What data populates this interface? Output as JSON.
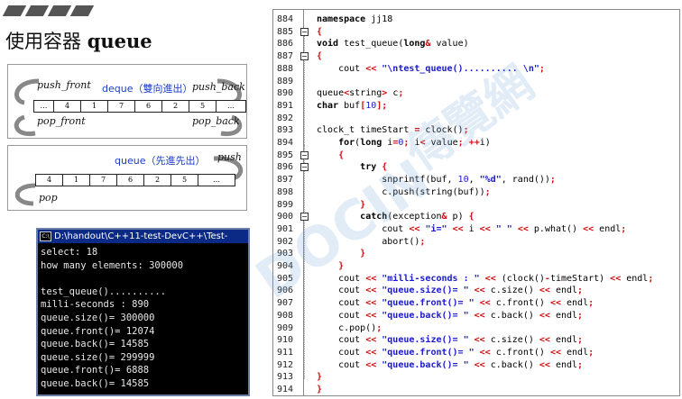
{
  "heading": {
    "title_prefix": "使用容器",
    "title_word": "queue"
  },
  "deque_diagram": {
    "title": "deque（雙向進出）",
    "push_front": "push_front",
    "push_back": "push_back",
    "pop_front": "pop_front",
    "pop_back": "pop_back",
    "cells": [
      "…",
      "4",
      "1",
      "7",
      "6",
      "2",
      "5",
      "…"
    ]
  },
  "queue_diagram": {
    "title": "queue（先進先出）",
    "push": "push",
    "pop": "pop",
    "cells": [
      "4",
      "1",
      "7",
      "6",
      "2",
      "5",
      "…"
    ]
  },
  "console": {
    "title": "D:\\handout\\C++11-test-DevC++\\Test-",
    "icon": "C:\\",
    "lines": [
      "select: 18",
      "how many elements: 300000",
      "",
      "test_queue()..........",
      "milli-seconds : 890",
      "queue.size()= 300000",
      "queue.front()= 12074",
      "queue.back()= 14585",
      "queue.size()= 299999",
      "queue.front()= 6888",
      "queue.back()= 14585"
    ]
  },
  "code": {
    "lines": [
      {
        "n": "884",
        "html": "<span class=\"kw\">namespace</span> jj18"
      },
      {
        "n": "885",
        "html": "<span class=\"op\">{</span>"
      },
      {
        "n": "886",
        "html": "<span class=\"kw\">void</span> test_queue(<span class=\"kw\">long</span><span class=\"op\">&amp;</span> value)"
      },
      {
        "n": "887",
        "html": "<span class=\"op\">{</span>"
      },
      {
        "n": "888",
        "html": "    cout <span class=\"op\">&lt;&lt;</span> <span class=\"str\">\"\\ntest_queue().......... \\n\"</span><span class=\"op\">;</span>"
      },
      {
        "n": "889",
        "html": ""
      },
      {
        "n": "890",
        "html": "queue<span class=\"op\">&lt;</span>string<span class=\"op\">&gt;</span> c<span class=\"op\">;</span>"
      },
      {
        "n": "891",
        "html": "<span class=\"kw\">char</span> buf<span class=\"op\">[</span><span class=\"num\">10</span><span class=\"op\">];</span>"
      },
      {
        "n": "892",
        "html": ""
      },
      {
        "n": "893",
        "html": "clock_t timeStart <span class=\"op\">=</span> clock()<span class=\"op\">;</span>"
      },
      {
        "n": "894",
        "html": "    <span class=\"kw\">for</span>(<span class=\"kw\">long</span> i<span class=\"op\">=</span><span class=\"num\">0</span><span class=\"op\">;</span> i<span class=\"op\">&lt;</span> value<span class=\"op\">;</span> <span class=\"op\">++</span>i)"
      },
      {
        "n": "895",
        "html": "    <span class=\"op\">{</span>"
      },
      {
        "n": "896",
        "html": "        <span class=\"kw\">try</span> <span class=\"op\">{</span>"
      },
      {
        "n": "897",
        "html": "            snprintf(buf, <span class=\"num\">10</span>, <span class=\"str\">\"%d\"</span>, rand())<span class=\"op\">;</span>"
      },
      {
        "n": "898",
        "html": "            c.push(string(buf))<span class=\"op\">;</span>"
      },
      {
        "n": "899",
        "html": "        <span class=\"op\">}</span>"
      },
      {
        "n": "900",
        "html": "        <span class=\"kw\">catch</span>(exception<span class=\"op\">&amp;</span> p) <span class=\"op\">{</span>"
      },
      {
        "n": "901",
        "html": "            cout <span class=\"op\">&lt;&lt;</span> <span class=\"str\">\"i=\"</span> <span class=\"op\">&lt;&lt;</span> i <span class=\"op\">&lt;&lt;</span> <span class=\"str\">\" \"</span> <span class=\"op\">&lt;&lt;</span> p.what() <span class=\"op\">&lt;&lt;</span> endl<span class=\"op\">;</span>"
      },
      {
        "n": "902",
        "html": "            abort()<span class=\"op\">;</span>"
      },
      {
        "n": "903",
        "html": "        <span class=\"op\">}</span>"
      },
      {
        "n": "904",
        "html": "    <span class=\"op\">}</span>"
      },
      {
        "n": "905",
        "html": "    cout <span class=\"op\">&lt;&lt;</span> <span class=\"str\">\"milli-seconds : \"</span> <span class=\"op\">&lt;&lt;</span> (clock()<span class=\"op\">-</span>timeStart) <span class=\"op\">&lt;&lt;</span> endl<span class=\"op\">;</span>"
      },
      {
        "n": "906",
        "html": "    cout <span class=\"op\">&lt;&lt;</span> <span class=\"str\">\"queue.size()= \"</span> <span class=\"op\">&lt;&lt;</span> c.size() <span class=\"op\">&lt;&lt;</span> endl<span class=\"op\">;</span>"
      },
      {
        "n": "907",
        "html": "    cout <span class=\"op\">&lt;&lt;</span> <span class=\"str\">\"queue.front()= \"</span> <span class=\"op\">&lt;&lt;</span> c.front() <span class=\"op\">&lt;&lt;</span> endl<span class=\"op\">;</span>"
      },
      {
        "n": "908",
        "html": "    cout <span class=\"op\">&lt;&lt;</span> <span class=\"str\">\"queue.back()= \"</span> <span class=\"op\">&lt;&lt;</span> c.back() <span class=\"op\">&lt;&lt;</span> endl<span class=\"op\">;</span>"
      },
      {
        "n": "909",
        "html": "    c.pop()<span class=\"op\">;</span>"
      },
      {
        "n": "910",
        "html": "    cout <span class=\"op\">&lt;&lt;</span> <span class=\"str\">\"queue.size()= \"</span> <span class=\"op\">&lt;&lt;</span> c.size() <span class=\"op\">&lt;&lt;</span> endl<span class=\"op\">;</span>"
      },
      {
        "n": "911",
        "html": "    cout <span class=\"op\">&lt;&lt;</span> <span class=\"str\">\"queue.front()= \"</span> <span class=\"op\">&lt;&lt;</span> c.front() <span class=\"op\">&lt;&lt;</span> endl<span class=\"op\">;</span>"
      },
      {
        "n": "912",
        "html": "    cout <span class=\"op\">&lt;&lt;</span> <span class=\"str\">\"queue.back()= \"</span> <span class=\"op\">&lt;&lt;</span> c.back() <span class=\"op\">&lt;&lt;</span> endl<span class=\"op\">;</span>"
      },
      {
        "n": "913",
        "html": "<span class=\"op\">}</span>"
      },
      {
        "n": "914",
        "html": "<span class=\"op\">}</span>"
      }
    ],
    "fold_markers": [
      {
        "line": 1,
        "symbol": "−"
      },
      {
        "line": 3,
        "symbol": "−"
      },
      {
        "line": 11,
        "symbol": "−"
      },
      {
        "line": 12,
        "symbol": "−"
      },
      {
        "line": 16,
        "symbol": "−"
      }
    ]
  },
  "watermark": {
    "text": "傳覽網",
    "sub": "DOCIN"
  },
  "colors": {
    "console_title_bg": "#0b2a86",
    "keyword_op": "#d01010",
    "string": "#1a1acc",
    "diagram_title": "#1a3cc8"
  }
}
